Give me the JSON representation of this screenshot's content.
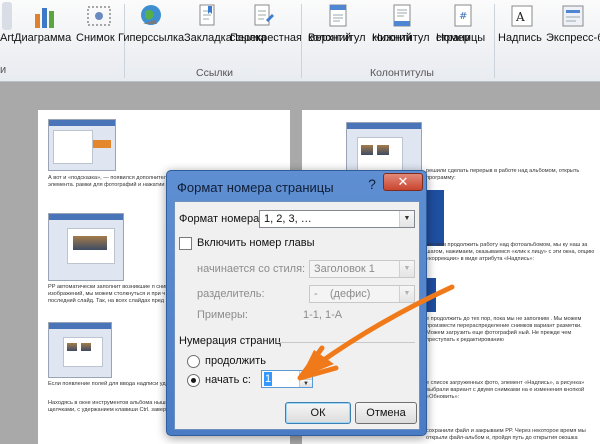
{
  "ribbon": {
    "left_cut": "Art",
    "left_cut2": "и",
    "buttons": {
      "chart": "Диаграмма",
      "screenshot": "Снимок",
      "hyperlink": "Гиперссылка",
      "bookmark": "Закладка",
      "crossref_1": "Перекрестная",
      "crossref_2": "ссылка",
      "header_1": "Верхний",
      "header_2": "колонтитул",
      "footer_1": "Нижний",
      "footer_2": "колонтитул",
      "pagenum_1": "Номер",
      "pagenum_2": "страницы",
      "textbox": "Надпись",
      "express": "Экспресс-бл"
    },
    "groups": {
      "links": "Ссылки",
      "headers_footers": "Колонтитулы"
    }
  },
  "document": {
    "left_text_1": "А вот и «подсказка», — появился дополнительный всплывающего без нашего согласия элемента. рамки для фотографий и нажатии кнопки появится поле ввода надписи:",
    "left_text_2": "PP автоматически заполнит возникшие п снимков, сохраняя пропорции. С пропорцией же изображений, мы можем столкнуться и при ч этот их расположение на слайдах не последний слайд. Так, на всех слайдах пред",
    "left_text_3": "Если появление полей для ввода надписи удалить. Процедура удаления проста и не д",
    "left_text_4": "Находясь в окне инструментов альбома ныши. Если элементов несколько, и вы щелчками, с удержанием клавиши Ctrl. завершении процедуры удаления, кнопку «",
    "right_text_1": "решили сделать перерыв в работе над альбомом, открыть программу:",
    "right_text_2": "желаем продолжить работу над фотоальбомом, мы ку наш за шагом, нажимаем, оказываемся «клик к лицу» с эти окна, опцию «коррекции» в виде атрибута «Надпись»:",
    "right_text_3": "е продолжить до тех пор, пока мы не заполним . Мы можем произвести перераспределение снимков вариант разметки. Можем загрузить еще фотографий ный. Не прежде чем преступать к редактированию",
    "right_text_4": "е список загруженных фото, элемент «Надпись», а рисунка» выбрали вариант с двумя снимками на е изменения кнопкой «Обновить»:",
    "right_text_5": "сохранили файл и закрываем PP. Через некоторое время мы открыли файл-альбом и, пройдя путь до открытия окошка"
  },
  "dialog": {
    "title": "Формат номера страницы",
    "help": "?",
    "close": "✕",
    "number_format_label": "Формат номера:",
    "number_format_value": "1, 2, 3, …",
    "include_chapter_label": "Включить номер главы",
    "starts_with_style_label": "начинается со стиля:",
    "starts_with_style_value": "Заголовок 1",
    "separator_label": "разделитель:",
    "separator_value": "-    (дефис)",
    "examples_label": "Примеры:",
    "examples_value": "1-1, 1-A",
    "numbering_group_label": "Нумерация страниц",
    "continue_label": "продолжить",
    "start_at_label": "начать с:",
    "start_at_value": "1",
    "ok_label": "ОК",
    "cancel_label": "Отмена"
  },
  "colors": {
    "dialog_frame": "#4a7cc6",
    "close_button": "#c9452f",
    "annotation_arrow": "#f07a1a",
    "selection": "#3399ff"
  }
}
